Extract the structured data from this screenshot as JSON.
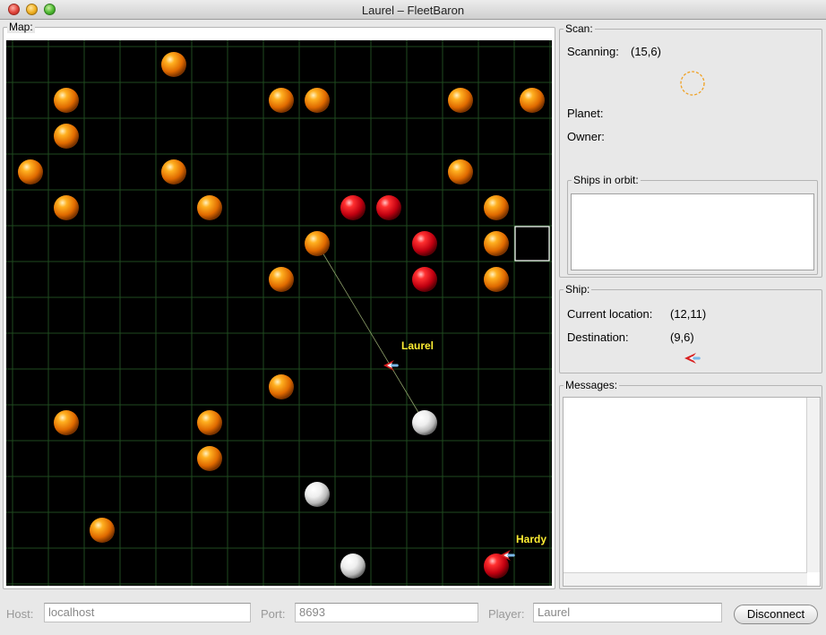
{
  "window": {
    "title": "Laurel – FleetBaron"
  },
  "map": {
    "label": "Map:",
    "grid": {
      "cols": 15,
      "rows": 15
    },
    "selected_cell": [
      14,
      5
    ],
    "planets": [
      {
        "x": 4,
        "y": 0,
        "owner": "neutral"
      },
      {
        "x": 1,
        "y": 1,
        "owner": "neutral"
      },
      {
        "x": 7,
        "y": 1,
        "owner": "neutral"
      },
      {
        "x": 8,
        "y": 1,
        "owner": "neutral"
      },
      {
        "x": 12,
        "y": 1,
        "owner": "neutral"
      },
      {
        "x": 14,
        "y": 1,
        "owner": "neutral"
      },
      {
        "x": 1,
        "y": 2,
        "owner": "neutral"
      },
      {
        "x": 0,
        "y": 3,
        "owner": "neutral"
      },
      {
        "x": 4,
        "y": 3,
        "owner": "neutral"
      },
      {
        "x": 12,
        "y": 3,
        "owner": "neutral"
      },
      {
        "x": 1,
        "y": 4,
        "owner": "neutral"
      },
      {
        "x": 5,
        "y": 4,
        "owner": "neutral"
      },
      {
        "x": 9,
        "y": 4,
        "owner": "enemy"
      },
      {
        "x": 10,
        "y": 4,
        "owner": "enemy"
      },
      {
        "x": 13,
        "y": 4,
        "owner": "neutral"
      },
      {
        "x": 8,
        "y": 5,
        "owner": "neutral"
      },
      {
        "x": 11,
        "y": 5,
        "owner": "enemy"
      },
      {
        "x": 13,
        "y": 5,
        "owner": "neutral"
      },
      {
        "x": 7,
        "y": 6,
        "owner": "neutral"
      },
      {
        "x": 11,
        "y": 6,
        "owner": "enemy"
      },
      {
        "x": 13,
        "y": 6,
        "owner": "neutral"
      },
      {
        "x": 7,
        "y": 9,
        "owner": "neutral"
      },
      {
        "x": 1,
        "y": 10,
        "owner": "neutral"
      },
      {
        "x": 5,
        "y": 10,
        "owner": "neutral"
      },
      {
        "x": 11,
        "y": 10,
        "owner": "own"
      },
      {
        "x": 5,
        "y": 11,
        "owner": "neutral"
      },
      {
        "x": 8,
        "y": 12,
        "owner": "own"
      },
      {
        "x": 2,
        "y": 13,
        "owner": "neutral"
      },
      {
        "x": 9,
        "y": 14,
        "owner": "own"
      },
      {
        "x": 13,
        "y": 14,
        "owner": "enemy"
      }
    ],
    "ships": [
      {
        "name": "Laurel",
        "x": 10.55,
        "y": 8.9,
        "label_dx": 0.3,
        "label_dy": -0.45
      },
      {
        "name": "Hardy",
        "x": 13.8,
        "y": 14.2,
        "label_dx": 0.25,
        "label_dy": -0.35
      }
    ],
    "route": {
      "from": [
        8,
        5
      ],
      "to": [
        11,
        10
      ]
    },
    "colors": {
      "grid": "#1f4a1f",
      "neutral": "#ff8c00",
      "enemy": "#e01010",
      "own": "#ffffff",
      "label": "#ffee33",
      "selection": "#ffffff"
    }
  },
  "scan": {
    "label": "Scan:",
    "scanning_label": "Scanning:",
    "scanning_value": "(15,6)",
    "planet_label": "Planet:",
    "owner_label": "Owner:",
    "orbit_label": "Ships in orbit:"
  },
  "ship": {
    "label": "Ship:",
    "location_label": "Current location:",
    "location_value": "(12,11)",
    "destination_label": "Destination:",
    "destination_value": "(9,6)"
  },
  "messages": {
    "label": "Messages:"
  },
  "connection": {
    "host_label": "Host:",
    "host_value": "localhost",
    "port_label": "Port:",
    "port_value": "8693",
    "player_label": "Player:",
    "player_value": "Laurel",
    "disconnect_label": "Disconnect"
  }
}
